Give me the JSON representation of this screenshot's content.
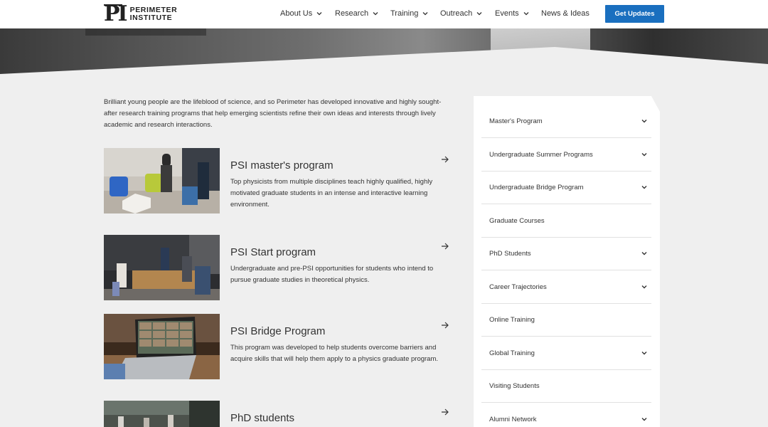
{
  "logo": {
    "mark": "PI",
    "line1": "PERIMETER",
    "line2": "INSTITUTE"
  },
  "nav": {
    "items": [
      {
        "label": "About Us",
        "dropdown": true
      },
      {
        "label": "Research",
        "dropdown": true
      },
      {
        "label": "Training",
        "dropdown": true
      },
      {
        "label": "Outreach",
        "dropdown": true
      },
      {
        "label": "Events",
        "dropdown": true
      },
      {
        "label": "News & Ideas",
        "dropdown": false
      }
    ],
    "cta_label": "Get Updates"
  },
  "colors": {
    "accent": "#1a6fbf",
    "background": "#efefef",
    "sidebar_bg": "#ffffff",
    "text": "#333333"
  },
  "intro": "Brilliant young people are the lifeblood of science, and so Perimeter has developed innovative and highly sought-after research training programs that help emerging scientists refine their own ideas and interests through lively academic and research interactions.",
  "programs": [
    {
      "title": "PSI master's program",
      "description": "Top physicists from multiple disciplines teach highly qualified, highly motivated graduate students in an intense and interactive learning environment.",
      "icon": "arrow-right-icon"
    },
    {
      "title": "PSI Start program",
      "description": "Undergraduate and pre-PSI opportunities for students who intend to pursue graduate studies in theoretical physics.",
      "icon": "arrow-right-icon"
    },
    {
      "title": "PSI Bridge Program",
      "description": "This program was developed to help students overcome barriers and acquire skills that will help them apply to a physics graduate program.",
      "icon": "arrow-right-icon"
    },
    {
      "title": "PhD students",
      "description": "",
      "icon": "arrow-right-icon"
    }
  ],
  "sidebar": {
    "items": [
      {
        "label": "Master's Program",
        "expandable": true
      },
      {
        "label": "Undergraduate Summer Programs",
        "expandable": true
      },
      {
        "label": "Undergraduate Bridge Program",
        "expandable": true
      },
      {
        "label": "Graduate Courses",
        "expandable": false
      },
      {
        "label": "PhD Students",
        "expandable": true
      },
      {
        "label": "Career Trajectories",
        "expandable": true
      },
      {
        "label": "Online Training",
        "expandable": false
      },
      {
        "label": "Global Training",
        "expandable": true
      },
      {
        "label": "Visiting Students",
        "expandable": false
      },
      {
        "label": "Alumni Network",
        "expandable": true
      }
    ]
  }
}
